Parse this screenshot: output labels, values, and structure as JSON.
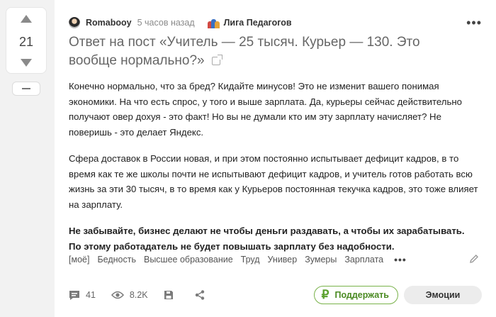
{
  "rating": {
    "value": "21"
  },
  "post": {
    "author": "Romabooy",
    "time": "5 часов назад",
    "community": "Лига Педагогов",
    "title": "Ответ на пост «Учитель — 25 тысяч. Курьер — 130. Это вообще нормально?»",
    "paragraphs": [
      "Конечно нормально, что за бред? Кидайте минусов! Это не изменит вашего понимая экономики. На что есть спрос, у того и выше зарплата. Да, курьеры сейчас действительно получают овер дохуя - это факт! Но вы не думали кто им эту зарплату начисляет? Не поверишь - это делает Яндекс.",
      "Сфера доставок в России новая, и при этом постоянно испытывает дефицит кадров, в то время как те же школы почти не испытывают дефицит кадров, и учитель готов работать всю жизнь за эти 30 тысяч, в то время как у Курьеров постоянная текучка кадров, это тоже влияет на зарплату.",
      "Не забывайте, бизнес делают не чтобы деньги раздавать, а чтобы их зарабатывать. По этому работадатель не будет повышать зарплату без надобности."
    ],
    "tags": [
      "[моё]",
      "Бедность",
      "Высшее образование",
      "Труд",
      "Универ",
      "Зумеры",
      "Зарплата"
    ],
    "tags_more": "•••",
    "more": "•••"
  },
  "footer": {
    "comments": "41",
    "views": "8.2K",
    "support_label": "Поддержать",
    "support_symbol": "₽",
    "emotions_label": "Эмоции"
  },
  "colors": {
    "accent_green": "#79b24a",
    "background": "#f2f2f2"
  }
}
